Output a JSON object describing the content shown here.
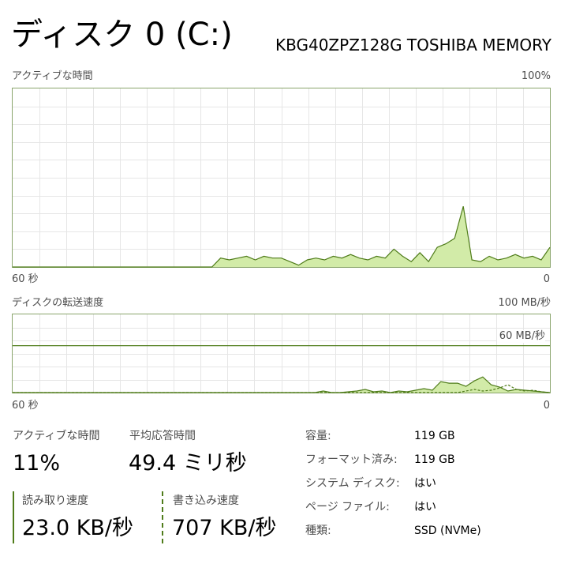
{
  "header": {
    "title": "ディスク 0 (C:)",
    "model": "KBG40ZPZ128G TOSHIBA MEMORY"
  },
  "active_time_chart": {
    "label": "アクティブな時間",
    "max_label": "100%",
    "x_left_label": "60 秒",
    "x_right_label": "0"
  },
  "transfer_chart": {
    "label": "ディスクの転送速度",
    "max_label": "100 MB/秒",
    "ref_line_label": "60 MB/秒",
    "x_left_label": "60 秒",
    "x_right_label": "0"
  },
  "chart_data": [
    {
      "type": "area",
      "title": "アクティブな時間",
      "ylim": [
        0,
        100
      ],
      "x": [
        0,
        2,
        3,
        5,
        6,
        7,
        8,
        9,
        10,
        11,
        12,
        13,
        14,
        15,
        16,
        17,
        18,
        19,
        20,
        21,
        22,
        23,
        24,
        25,
        26,
        27,
        28,
        29,
        30,
        31,
        32,
        33,
        34,
        35,
        36,
        37,
        38,
        39,
        40,
        41,
        42,
        43,
        44,
        45,
        46,
        47,
        48,
        49,
        50,
        51,
        52,
        53,
        54,
        55,
        56,
        57,
        58,
        59,
        60
      ],
      "series": [
        {
          "values": [
            0,
            0,
            0,
            0,
            0,
            0,
            0,
            0,
            0,
            0,
            0,
            0,
            0,
            0,
            0,
            0,
            0,
            0,
            0,
            0,
            0,
            0,
            0,
            0,
            5,
            4,
            5,
            6,
            4,
            6,
            5,
            5,
            3,
            1,
            4,
            5,
            4,
            6,
            5,
            7,
            5,
            4,
            6,
            5,
            10,
            6,
            3,
            8,
            3,
            11,
            13,
            16,
            34,
            4,
            3,
            6,
            4,
            5,
            7,
            5,
            6,
            4,
            11
          ]
        }
      ],
      "grid": true
    },
    {
      "type": "area",
      "title": "ディスクの転送速度",
      "ylim": [
        0,
        100
      ],
      "series": [
        {
          "name": "読み取り速度",
          "values": [
            0,
            0,
            0,
            0,
            0,
            0,
            0,
            0,
            0,
            0,
            0,
            0,
            0,
            0,
            0,
            0,
            0,
            0,
            0,
            0,
            0,
            0,
            0,
            0,
            0,
            0,
            0,
            0,
            0,
            0,
            0,
            0,
            0,
            0,
            0,
            0,
            0,
            2,
            0,
            0,
            1,
            2,
            4,
            1,
            2,
            0,
            2,
            1,
            3,
            5,
            3,
            14,
            12,
            12,
            8,
            15,
            20,
            10,
            7,
            2,
            4,
            3,
            2,
            1,
            0
          ]
        },
        {
          "name": "書き込み速度",
          "values": [
            0,
            0,
            0,
            0,
            0,
            0,
            0,
            0,
            0,
            0,
            0,
            0,
            0,
            0,
            0,
            0,
            0,
            0,
            0,
            0,
            0,
            0,
            0,
            0,
            0,
            0,
            0,
            0,
            0,
            0,
            0,
            0,
            0,
            0,
            0,
            0,
            0,
            0,
            0,
            0,
            0,
            0,
            0,
            0,
            0,
            0,
            0,
            0,
            0,
            0,
            0,
            0,
            0,
            0,
            2,
            4,
            2,
            3,
            6,
            10,
            4,
            2,
            3,
            1,
            0
          ]
        }
      ],
      "reference_line": 60,
      "grid": true
    }
  ],
  "stats": {
    "active_time_label": "アクティブな時間",
    "active_time_value": "11%",
    "response_label": "平均応答時間",
    "response_value": "49.4 ミリ秒",
    "read_label": "読み取り速度",
    "read_value": "23.0 KB/秒",
    "write_label": "書き込み速度",
    "write_value": "707 KB/秒"
  },
  "properties": [
    {
      "label": "容量:",
      "value": "119 GB"
    },
    {
      "label": "フォーマット済み:",
      "value": "119 GB"
    },
    {
      "label": "システム ディスク:",
      "value": "はい"
    },
    {
      "label": "ページ ファイル:",
      "value": "はい"
    },
    {
      "label": "種類:",
      "value": "SSD (NVMe)"
    }
  ],
  "colors": {
    "accent": "#4f7c1a",
    "fill": "#d2eba8",
    "grid": "#e6e6e6",
    "border": "#8aa56c"
  }
}
